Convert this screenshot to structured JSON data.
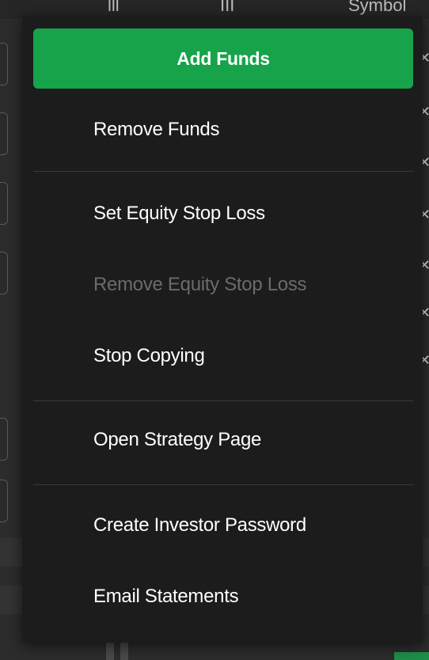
{
  "background": {
    "header_labels": [
      "lll",
      "III",
      "Symbol"
    ],
    "colors": {
      "backdrop": "#2c2c2c",
      "accent_green": "#16a34a"
    }
  },
  "menu": {
    "items": [
      {
        "label": "Add Funds",
        "style": "primary",
        "enabled": true
      },
      {
        "label": "Remove Funds",
        "style": "normal",
        "enabled": true
      },
      {
        "label": "Set Equity Stop Loss",
        "style": "normal",
        "enabled": true
      },
      {
        "label": "Remove Equity Stop Loss",
        "style": "normal",
        "enabled": false
      },
      {
        "label": "Stop Copying",
        "style": "normal",
        "enabled": true
      },
      {
        "label": "Open Strategy Page",
        "style": "normal",
        "enabled": true
      },
      {
        "label": "Create Investor Password",
        "style": "normal",
        "enabled": true
      },
      {
        "label": "Email Statements",
        "style": "normal",
        "enabled": true
      }
    ],
    "colors": {
      "panel": "#1c1c1c",
      "text": "#ffffff",
      "disabled_text": "#6b6b6b",
      "divider": "#3a3a3a",
      "primary_button": "#16a34a"
    }
  }
}
